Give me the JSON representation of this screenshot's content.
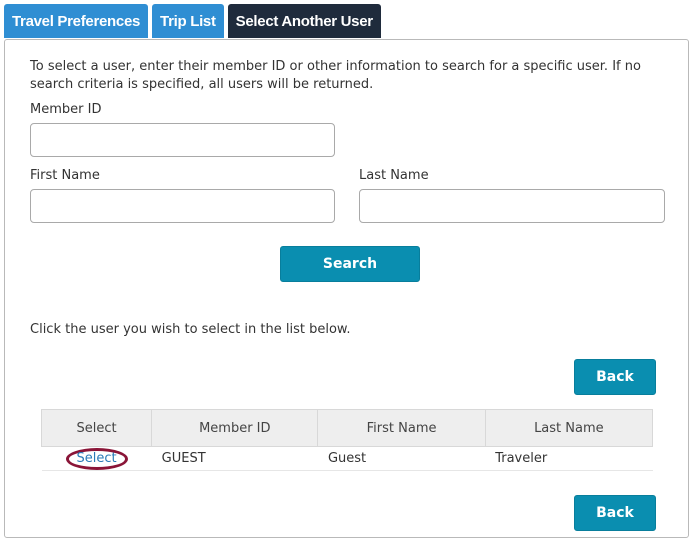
{
  "tabs": [
    {
      "label": "Travel Preferences"
    },
    {
      "label": "Trip List"
    },
    {
      "label": "Select Another User"
    }
  ],
  "intro_text": "To select a user, enter their member ID or other information to search for a specific user.  If no search criteria is specified, all users will be returned.",
  "form": {
    "member_id_label": "Member ID",
    "member_id_value": "",
    "first_name_label": "First Name",
    "first_name_value": "",
    "last_name_label": "Last Name",
    "last_name_value": "",
    "search_label": "Search"
  },
  "instruction_text": "Click the user you wish to select in the list below.",
  "back_label": "Back",
  "table": {
    "headers": [
      "Select",
      "Member ID",
      "First Name",
      "Last Name"
    ],
    "rows": [
      {
        "select": "Select",
        "member_id": "GUEST",
        "first_name": "Guest",
        "last_name": "Traveler"
      }
    ]
  },
  "colors": {
    "tab_blue": "#2f8ed3",
    "tab_active": "#1f2b3c",
    "button_teal": "#0a8eb0",
    "select_circle": "#8a1538"
  }
}
